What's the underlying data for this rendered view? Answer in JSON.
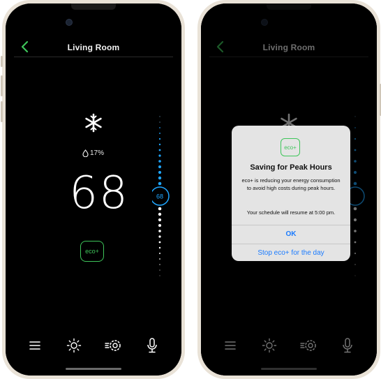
{
  "screen": {
    "title": "Living Room",
    "humidity": "17%",
    "setpoint": "68",
    "eco_label": "eco+",
    "slider_value": "68"
  },
  "tabbar": {
    "items": [
      {
        "name": "menu-icon"
      },
      {
        "name": "sun-icon"
      },
      {
        "name": "settings-icon"
      },
      {
        "name": "microphone-icon"
      }
    ]
  },
  "dialog": {
    "eco_label": "eco+",
    "title": "Saving for Peak Hours",
    "message": "eco+ is reducing your energy consumption to avoid high costs during peak hours.",
    "resume": "Your schedule will resume at 5:00 pm.",
    "ok": "OK",
    "stop": "Stop eco+ for the day"
  },
  "colors": {
    "accent_blue": "#1fa6ff",
    "eco_green": "#3ec55a",
    "dialog_link": "#1a7bff"
  }
}
